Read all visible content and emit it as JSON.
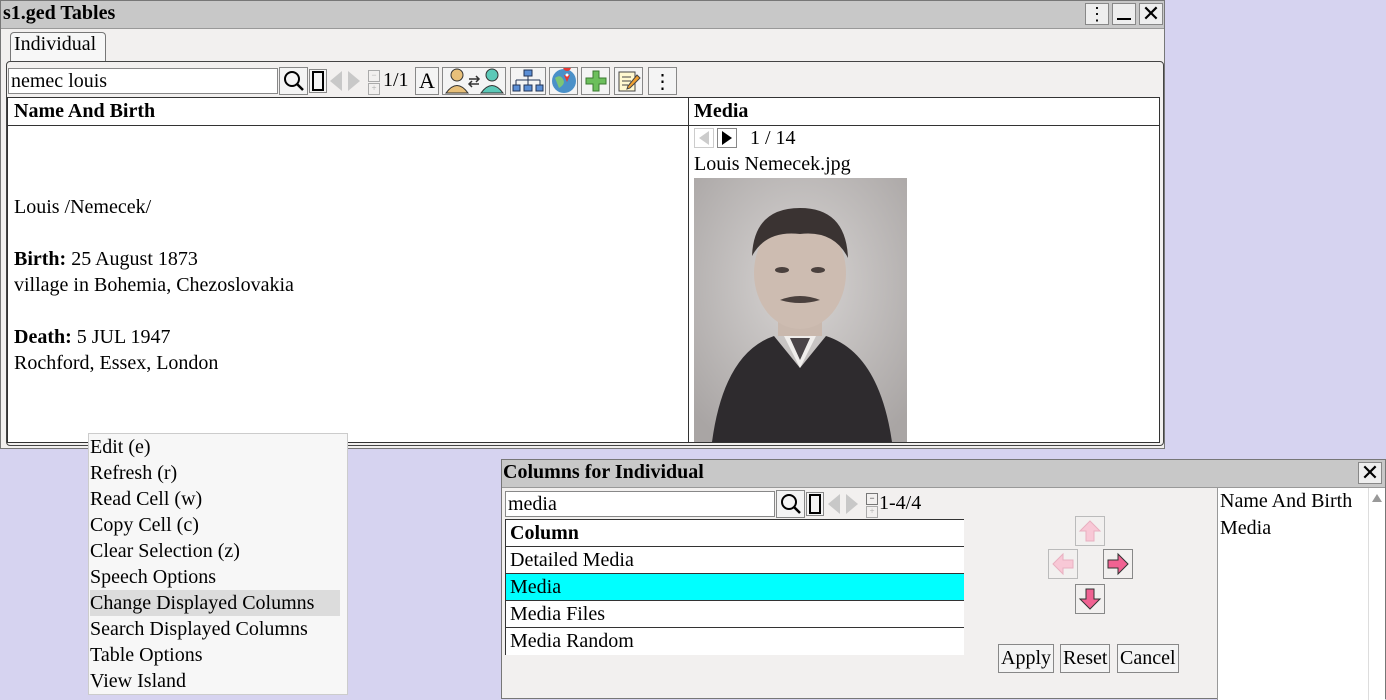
{
  "main_window": {
    "title": "s1.ged Tables",
    "tab": "Individual",
    "search_value": "nemec  louis",
    "match_count": "1/1",
    "font_button": "A",
    "columns": [
      "Name And Birth",
      "Media"
    ],
    "row": {
      "name": "Louis /Nemecek/",
      "birth_label": "Birth:",
      "birth_date": "25 August 1873",
      "birth_place": "village in Bohemia, Chezoslovakia",
      "death_label": "Death:",
      "death_date": "5 JUL 1947",
      "death_place": "Rochford, Essex, London",
      "media_counter": "1 / 14",
      "media_file": "Louis Nemecek.jpg"
    }
  },
  "context_menu": {
    "items": [
      "Edit (e)",
      "Refresh (r)",
      "Read Cell (w)",
      "Copy Cell (c)",
      "Clear Selection (z)",
      "Speech Options",
      "Change Displayed Columns",
      "Search Displayed Columns",
      "Table Options",
      "View Island"
    ],
    "selected": "Change Displayed Columns"
  },
  "columns_dialog": {
    "title": "Columns for Individual",
    "search_value": "media",
    "match_count": "1-4/4",
    "header": "Column",
    "available": [
      "Detailed Media",
      "Media",
      "Media Files",
      "Media Random"
    ],
    "selected_available": "Media",
    "displayed": [
      "Name And Birth",
      "Media"
    ],
    "buttons": {
      "apply": "Apply",
      "reset": "Reset",
      "cancel": "Cancel"
    }
  },
  "colors": {
    "selection": "#00ffff",
    "arrow_accent": "#f06292",
    "menu_highlight": "#dcdcdc"
  }
}
